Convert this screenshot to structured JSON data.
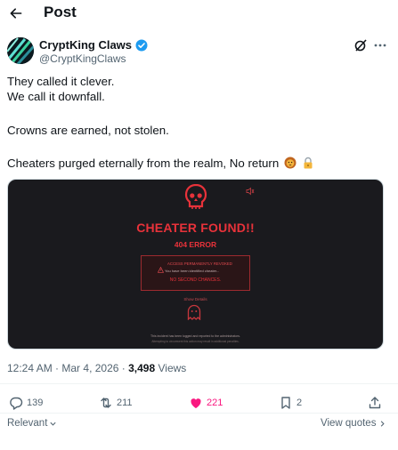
{
  "header": {
    "title": "Post"
  },
  "author": {
    "name": "CryptKing Claws",
    "handle": "@CryptKingClaws"
  },
  "tweet": {
    "lines": [
      "They called it clever.",
      "We call it downfall.",
      "Crowns are earned, not stolen.",
      "Cheaters purged eternally from the realm, No return"
    ]
  },
  "media": {
    "title": "CHEATER FOUND!!",
    "error": "404 ERROR",
    "box_line1": "ACCESS PERMANENTLY REVOKED",
    "box_line2": "You have been identified cheater...",
    "box_line3": "NO SECOND CHANCES.",
    "footer_link": "Show Details",
    "fine1": "This incident has been logged and reported to the administrators.",
    "fine2": "Attempting to circumvent this action may result in additional penalties."
  },
  "meta": {
    "time": "12:24 AM",
    "date": "Mar 4, 2026",
    "views_count": "3,498",
    "views_label": "Views"
  },
  "actions": {
    "replies": "139",
    "reposts": "211",
    "likes": "221",
    "bookmarks": "2"
  },
  "footer": {
    "sort_label": "Relevant",
    "view_quotes_label": "View quotes"
  },
  "colors": {
    "accent_red": "#e8323a",
    "like_pink": "#f91880",
    "verified_blue": "#1d9bf0"
  }
}
